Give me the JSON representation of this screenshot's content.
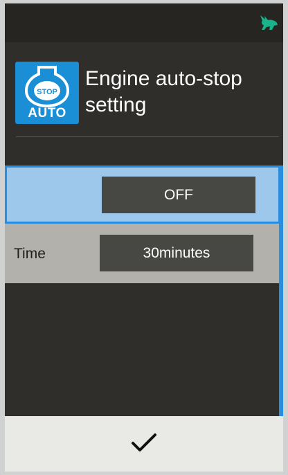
{
  "header": {
    "icon_top_text": "STOP",
    "icon_bottom_text": "AUTO",
    "title": "Engine auto-stop setting"
  },
  "rows": [
    {
      "label": "",
      "value": "OFF",
      "selected": true
    },
    {
      "label": "Time",
      "value": "30minutes",
      "selected": false
    }
  ],
  "footer": {
    "confirm_icon": "checkmark-icon"
  },
  "status": {
    "icon": "rabbit-icon"
  },
  "colors": {
    "accent": "#2a8ee0",
    "selected_row": "#9dc8ec",
    "icon_bg": "#1b8fd6",
    "status_icon": "#19b38a"
  }
}
